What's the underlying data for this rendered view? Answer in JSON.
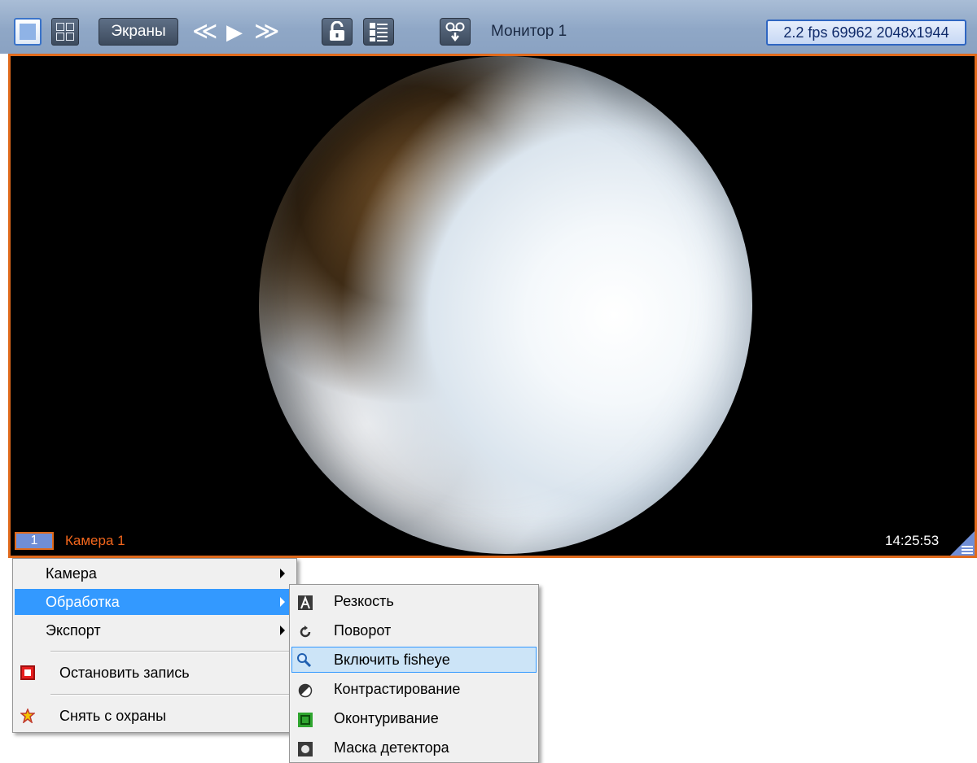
{
  "toolbar": {
    "screens_label": "Экраны",
    "nav_prev": "≪",
    "nav_play": "▶",
    "nav_next": "≫",
    "monitor_title": "Монитор 1",
    "stats": "2.2 fps  69962 2048x1944"
  },
  "video": {
    "camera_number": "1",
    "camera_name": "Камера 1",
    "timestamp": "14:25:53"
  },
  "context_menu": {
    "items": [
      {
        "label": "Камера",
        "submenu": true
      },
      {
        "label": "Обработка",
        "submenu": true,
        "selected": true
      },
      {
        "label": "Экспорт",
        "submenu": true
      },
      {
        "label": "Остановить запись",
        "icon": "stop-record-icon"
      },
      {
        "label": "Снять с охраны",
        "icon": "disarm-icon"
      }
    ]
  },
  "submenu": {
    "items": [
      {
        "label": "Резкость",
        "icon": "sharpness-icon"
      },
      {
        "label": "Поворот",
        "icon": "rotate-icon"
      },
      {
        "label": "Включить fisheye",
        "icon": "magnifier-icon",
        "highlighted": true
      },
      {
        "label": "Контрастирование",
        "icon": "contrast-icon"
      },
      {
        "label": "Оконтуривание",
        "icon": "contour-icon"
      },
      {
        "label": "Маска детектора",
        "icon": "detector-mask-icon"
      }
    ]
  },
  "colors": {
    "frame_border": "#e06a1c",
    "camera_label": "#f2661c",
    "menu_selected": "#3399ff",
    "menu_hover": "#cce4f7"
  }
}
